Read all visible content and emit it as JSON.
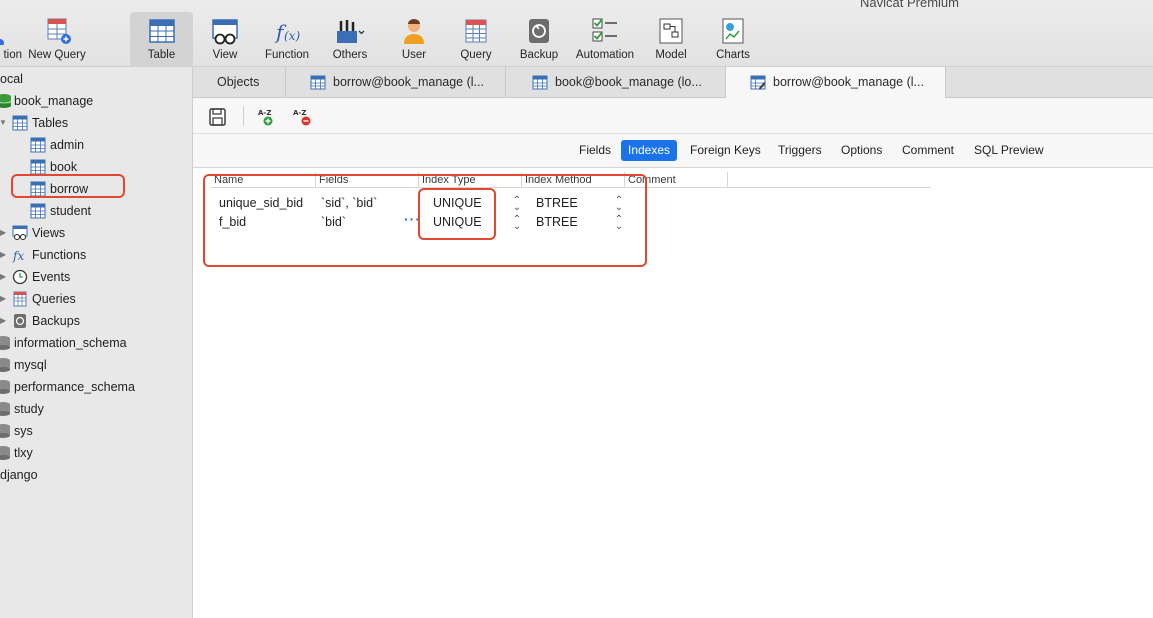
{
  "window_title": "Navicat Premium",
  "toolbar": {
    "items": [
      {
        "label": "tion",
        "icon": "connection-icon"
      },
      {
        "label": "New Query",
        "icon": "new-query-icon"
      },
      {
        "label": "Table",
        "icon": "table-icon",
        "active": true
      },
      {
        "label": "View",
        "icon": "view-icon"
      },
      {
        "label": "Function",
        "icon": "function-icon"
      },
      {
        "label": "Others",
        "icon": "others-icon"
      },
      {
        "label": "User",
        "icon": "user-icon"
      },
      {
        "label": "Query",
        "icon": "query-icon"
      },
      {
        "label": "Backup",
        "icon": "backup-icon"
      },
      {
        "label": "Automation",
        "icon": "automation-icon"
      },
      {
        "label": "Model",
        "icon": "model-icon"
      },
      {
        "label": "Charts",
        "icon": "charts-icon"
      }
    ]
  },
  "sidebar": {
    "items": [
      {
        "label": "ocal"
      },
      {
        "label": "book_manage"
      },
      {
        "label": "Tables"
      },
      {
        "label": "admin"
      },
      {
        "label": "book"
      },
      {
        "label": "borrow",
        "highlighted": true
      },
      {
        "label": "student"
      },
      {
        "label": "Views"
      },
      {
        "label": "Functions"
      },
      {
        "label": "Events"
      },
      {
        "label": "Queries"
      },
      {
        "label": "Backups"
      },
      {
        "label": "information_schema"
      },
      {
        "label": "mysql"
      },
      {
        "label": "performance_schema"
      },
      {
        "label": "study"
      },
      {
        "label": "sys"
      },
      {
        "label": "tlxy"
      },
      {
        "label": "django"
      }
    ]
  },
  "tabs": [
    {
      "label": "Objects"
    },
    {
      "label": "borrow@book_manage (l..."
    },
    {
      "label": "book@book_manage (lo..."
    },
    {
      "label": "borrow@book_manage (l...",
      "active": true
    }
  ],
  "subtabs": [
    {
      "label": "Fields"
    },
    {
      "label": "Indexes",
      "active": true
    },
    {
      "label": "Foreign Keys"
    },
    {
      "label": "Triggers"
    },
    {
      "label": "Options"
    },
    {
      "label": "Comment"
    },
    {
      "label": "SQL Preview"
    }
  ],
  "indexes": {
    "columns": [
      "Name",
      "Fields",
      "Index Type",
      "Index Method",
      "Comment"
    ],
    "rows": [
      {
        "name": "unique_sid_bid",
        "fields": "`sid`, `bid`",
        "type": "UNIQUE",
        "method": "BTREE",
        "comment": ""
      },
      {
        "name": "f_bid",
        "fields": "`bid`",
        "type": "UNIQUE",
        "method": "BTREE",
        "comment": ""
      }
    ],
    "more_symbol": "···"
  },
  "colors": {
    "accent": "#1a73e8",
    "highlight": "#e0492f"
  }
}
